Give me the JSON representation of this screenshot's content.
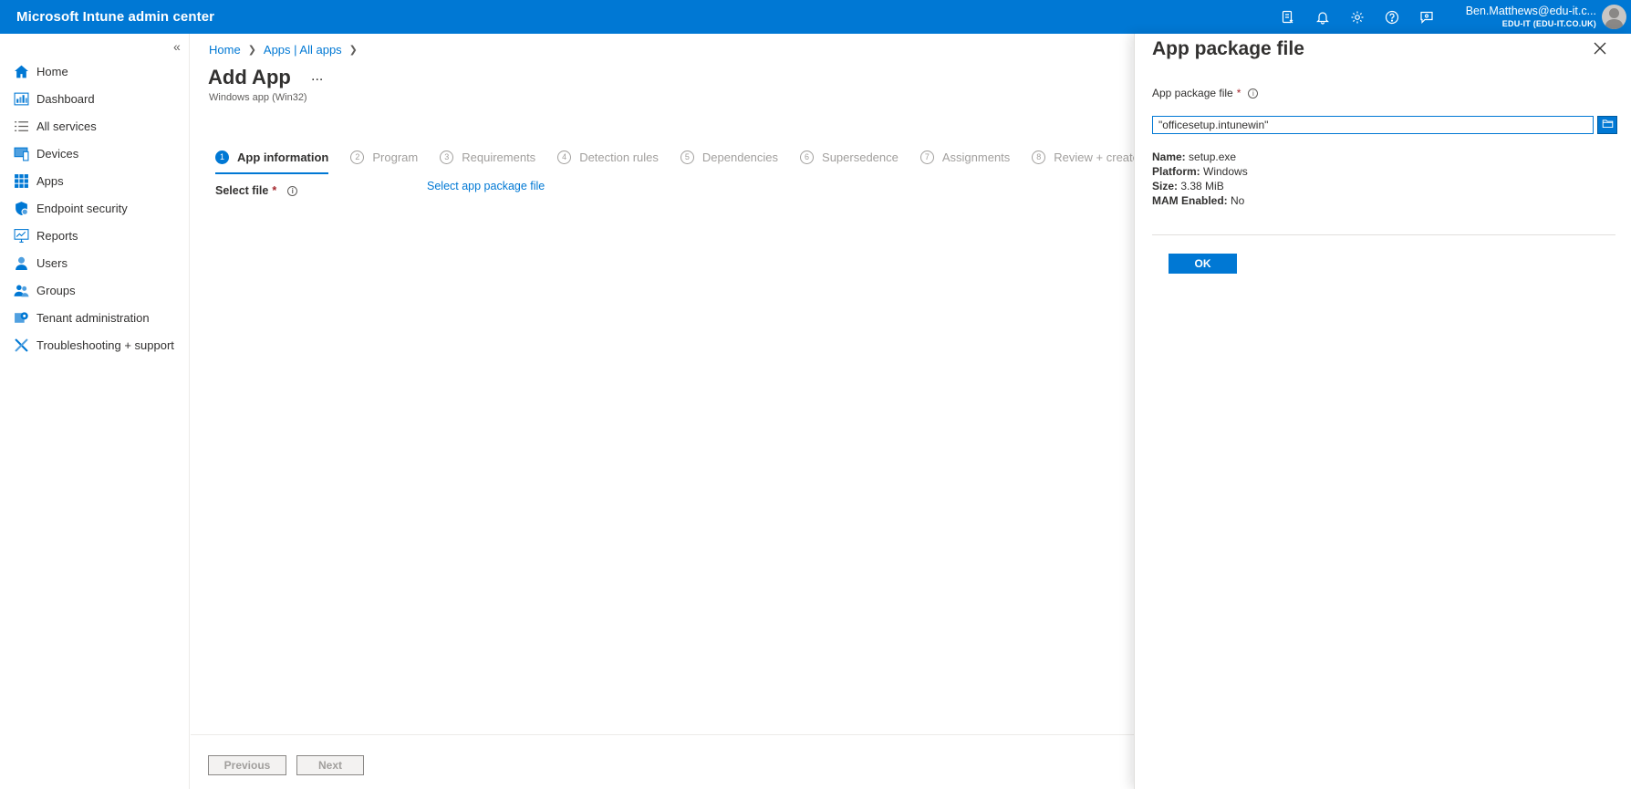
{
  "header": {
    "title": "Microsoft Intune admin center",
    "icons": [
      "remote-help-icon",
      "bell-icon",
      "gear-icon",
      "help-icon",
      "feedback-icon"
    ],
    "user_name": "Ben.Matthews@edu-it.c...",
    "tenant": "EDU-IT (EDU-IT.CO.UK)"
  },
  "sidebar": {
    "collapse_label": "«",
    "items": [
      {
        "label": "Home",
        "icon": "home-icon"
      },
      {
        "label": "Dashboard",
        "icon": "dashboard-icon"
      },
      {
        "label": "All services",
        "icon": "list-icon"
      },
      {
        "label": "Devices",
        "icon": "devices-icon"
      },
      {
        "label": "Apps",
        "icon": "apps-icon"
      },
      {
        "label": "Endpoint security",
        "icon": "shield-icon"
      },
      {
        "label": "Reports",
        "icon": "reports-icon"
      },
      {
        "label": "Users",
        "icon": "user-icon"
      },
      {
        "label": "Groups",
        "icon": "groups-icon"
      },
      {
        "label": "Tenant administration",
        "icon": "tenant-admin-icon"
      },
      {
        "label": "Troubleshooting + support",
        "icon": "tools-icon"
      }
    ]
  },
  "main": {
    "breadcrumb": [
      "Home",
      "Apps | All apps"
    ],
    "title": "Add App",
    "more": "...",
    "subtitle": "Windows app (Win32)",
    "steps": [
      {
        "num": "1",
        "label": "App information",
        "active": true
      },
      {
        "num": "2",
        "label": "Program"
      },
      {
        "num": "3",
        "label": "Requirements"
      },
      {
        "num": "4",
        "label": "Detection rules"
      },
      {
        "num": "5",
        "label": "Dependencies"
      },
      {
        "num": "6",
        "label": "Supersedence"
      },
      {
        "num": "7",
        "label": "Assignments"
      },
      {
        "num": "8",
        "label": "Review + create"
      }
    ],
    "select_file_label": "Select file",
    "required_mark": "*",
    "select_link": "Select app package file",
    "previous_label": "Previous",
    "next_label": "Next"
  },
  "blade": {
    "title": "App package file",
    "field_label": "App package file",
    "required_mark": "*",
    "file_value": "\"officesetup.intunewin\"",
    "meta": {
      "name_key": "Name:",
      "name_val": "setup.exe",
      "platform_key": "Platform:",
      "platform_val": "Windows",
      "size_key": "Size:",
      "size_val": "3.38 MiB",
      "mam_key": "MAM Enabled:",
      "mam_val": "No"
    },
    "ok_label": "OK"
  },
  "colors": {
    "accent": "#0078d4",
    "header_bg": "#0078d4",
    "required": "#a4262c"
  }
}
